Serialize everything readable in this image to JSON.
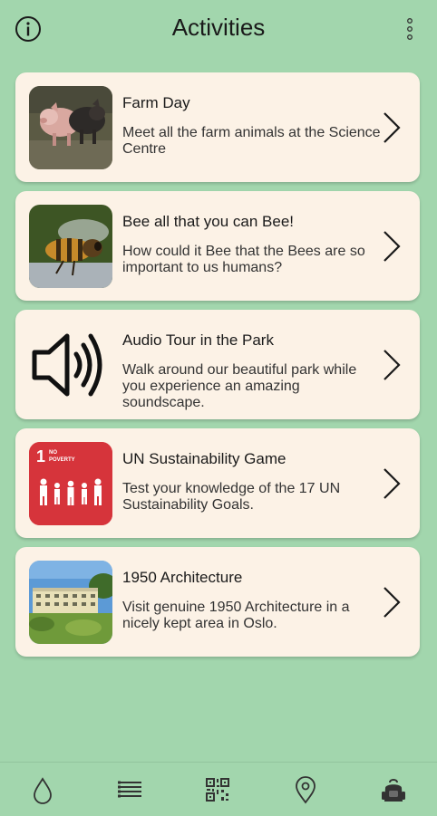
{
  "header": {
    "title": "Activities",
    "info_icon": "info-circle-icon",
    "more_icon": "more-vertical-icon"
  },
  "activities": [
    {
      "title": "Farm Day",
      "description": "Meet all the farm animals at the Science Centre",
      "image": "pigs-photo"
    },
    {
      "title": "Bee all that you can Bee!",
      "description": "How could it Bee that the Bees are so important to us humans?",
      "image": "bee-photo"
    },
    {
      "title": "Audio Tour in the Park",
      "description": "Walk around our beautiful park while you experience an amazing soundscape.",
      "image": "speaker-icon"
    },
    {
      "title": "UN Sustainability Game",
      "description": "Test your knowledge of the 17 UN Sustainability Goals.",
      "image": "sdg-no-poverty-logo",
      "logo_text": {
        "number": "1",
        "line1": "NO",
        "line2": "POVERTY"
      }
    },
    {
      "title": "1950 Architecture",
      "description": "Visit genuine 1950 Architecture in a nicely kept area in Oslo.",
      "image": "building-photo"
    }
  ],
  "bottom_nav": [
    {
      "icon": "drop-icon"
    },
    {
      "icon": "list-icon"
    },
    {
      "icon": "qr-code-icon"
    },
    {
      "icon": "location-pin-icon"
    },
    {
      "icon": "backpack-icon"
    }
  ],
  "colors": {
    "background": "#a2d6ad",
    "card": "#fcf2e6",
    "sdg_red": "#d6343b"
  }
}
